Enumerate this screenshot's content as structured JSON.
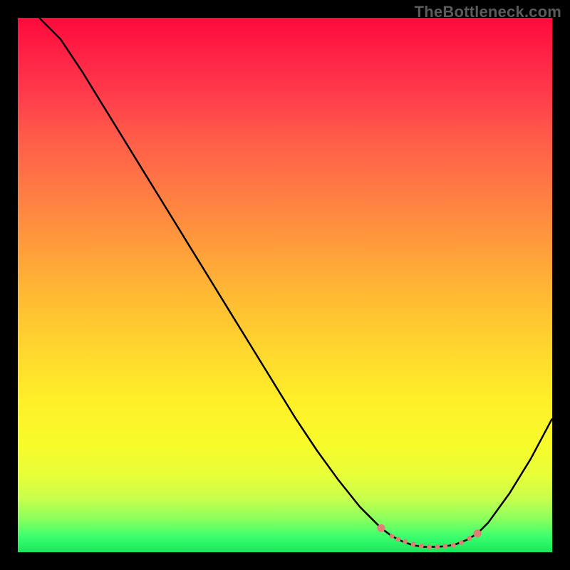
{
  "watermark": "TheBottleneck.com",
  "colors": {
    "curve": "#000000",
    "marker": "#e08075",
    "frame": "#000000"
  },
  "chart_data": {
    "type": "line",
    "title": "",
    "xlabel": "",
    "ylabel": "",
    "xlim": [
      0,
      100
    ],
    "ylim": [
      0,
      100
    ],
    "grid": false,
    "legend": false,
    "series": [
      {
        "name": "bottleneck-curve",
        "x": [
          4,
          8,
          12,
          16,
          20,
          24,
          28,
          32,
          36,
          40,
          44,
          48,
          52,
          56,
          60,
          64,
          68,
          70,
          72,
          74,
          76,
          78,
          80,
          82,
          84,
          86,
          88,
          92,
          96,
          100
        ],
        "y": [
          100,
          96,
          90,
          83.5,
          77,
          70.5,
          64,
          57.5,
          51,
          44.5,
          38,
          31.5,
          25,
          19,
          13.5,
          8.5,
          4.5,
          3,
          2,
          1.3,
          1,
          1,
          1.1,
          1.5,
          2.3,
          3.5,
          5.5,
          11,
          17.5,
          25
        ]
      }
    ],
    "markers": {
      "name": "valley-markers",
      "x": [
        68,
        70,
        71.2,
        72.5,
        74,
        75.5,
        77,
        78.5,
        80,
        81.5,
        83,
        84.5,
        86
      ],
      "y": [
        4.5,
        3.0,
        2.4,
        2.0,
        1.5,
        1.2,
        1.0,
        1.0,
        1.1,
        1.3,
        1.8,
        2.6,
        3.5
      ]
    }
  }
}
